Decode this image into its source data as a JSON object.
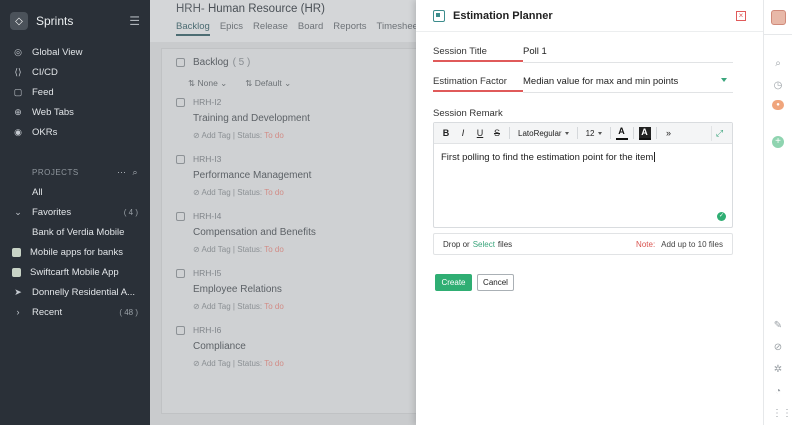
{
  "sidebar": {
    "title": "Sprints",
    "nav": [
      {
        "label": "Global View",
        "icon": "globe-icon"
      },
      {
        "label": "CI/CD",
        "icon": "code-icon"
      },
      {
        "label": "Feed",
        "icon": "feed-icon"
      },
      {
        "label": "Web Tabs",
        "icon": "web-icon"
      },
      {
        "label": "OKRs",
        "icon": "target-icon"
      }
    ],
    "projects_heading": "PROJECTS",
    "all_label": "All",
    "favorites_label": "Favorites",
    "favorites_count": "( 4 )",
    "favorites": [
      "Bank of Verdia Mobile",
      "Mobile apps for banks",
      "Swiftcarft Mobile App",
      "Donnelly Residential A..."
    ],
    "recent_label": "Recent",
    "recent_count": "( 48 )"
  },
  "project": {
    "prefix": "HRH-",
    "name": "Human Resource (HR)",
    "tabs": [
      "Backlog",
      "Epics",
      "Release",
      "Board",
      "Reports",
      "Timesheet"
    ]
  },
  "backlog": {
    "title": "Backlog",
    "count": "( 5 )",
    "filter_1": "None",
    "filter_2": "Default",
    "add_tag": "Add Tag",
    "status_label": "Status:",
    "status_value": "To do",
    "items": [
      {
        "id": "HRH-I2",
        "name": "Training and Development"
      },
      {
        "id": "HRH-I3",
        "name": "Performance Management"
      },
      {
        "id": "HRH-I4",
        "name": "Compensation and Benefits"
      },
      {
        "id": "HRH-I5",
        "name": "Employee Relations"
      },
      {
        "id": "HRH-I6",
        "name": "Compliance"
      }
    ]
  },
  "modal": {
    "title": "Estimation Planner",
    "session_title_label": "Session Title",
    "session_title_value": "Poll 1",
    "factor_label": "Estimation Factor",
    "factor_value": "Median value for max and min points",
    "remark_label": "Session Remark",
    "font_name": "LatoRegular",
    "font_size": "12",
    "remark_text": "First polling to find the estimation point for the item",
    "drop_prefix": "Drop or",
    "drop_select": "Select",
    "drop_suffix": "files",
    "note_label": "Note:",
    "note_text": "Add up to 10 files",
    "create_label": "Create",
    "cancel_label": "Cancel"
  },
  "colors": {
    "accent": "#2fae73",
    "error": "#e05a5a",
    "sidebar_bg": "#2a3038"
  }
}
